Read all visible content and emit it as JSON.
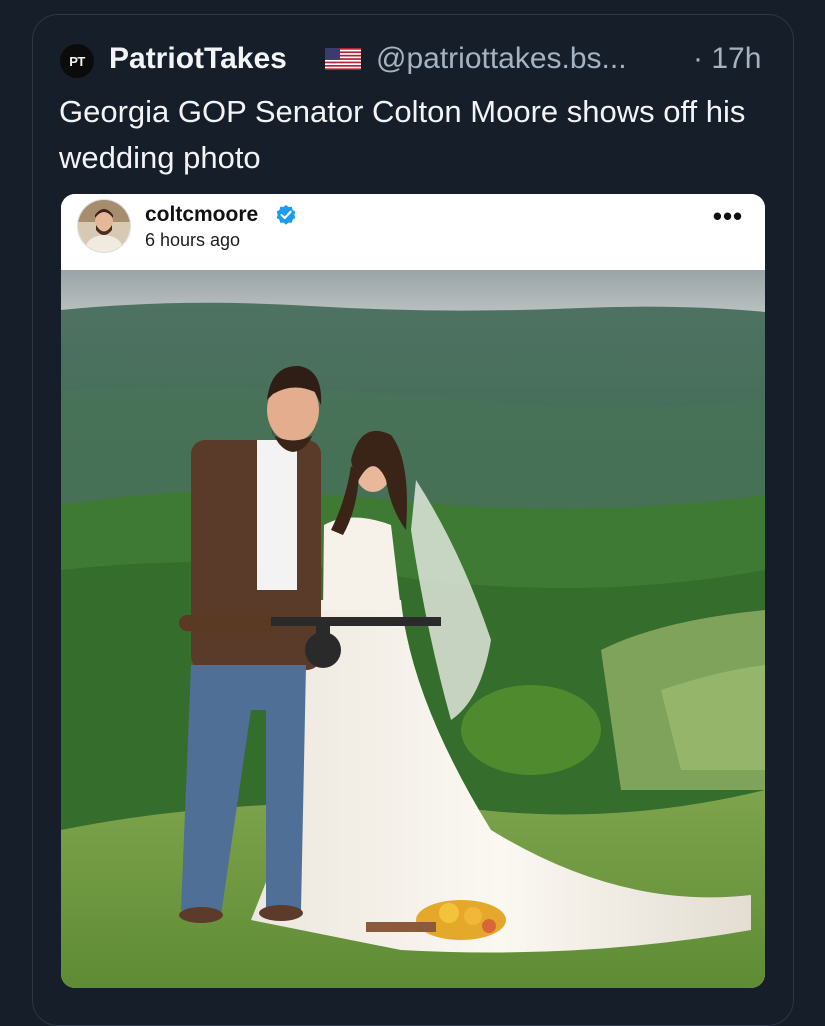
{
  "post": {
    "avatar_text": "PT",
    "author_name": "PatriotTakes",
    "author_handle": "@patriottakes.bs...",
    "time": "· 17h",
    "text": "Georgia GOP Senator Colton Moore shows off his wedding photo",
    "flag_icon": "us-flag-icon"
  },
  "embed": {
    "username": "coltcmoore",
    "timestamp": "6 hours ago",
    "verified": true,
    "more_icon": "more-horizontal-icon",
    "more_label": "•••"
  },
  "colors": {
    "background": "#161e2a",
    "text_primary": "#f2f4f7",
    "text_secondary": "#a5b2c2",
    "verified_blue": "#1d9bf0"
  }
}
